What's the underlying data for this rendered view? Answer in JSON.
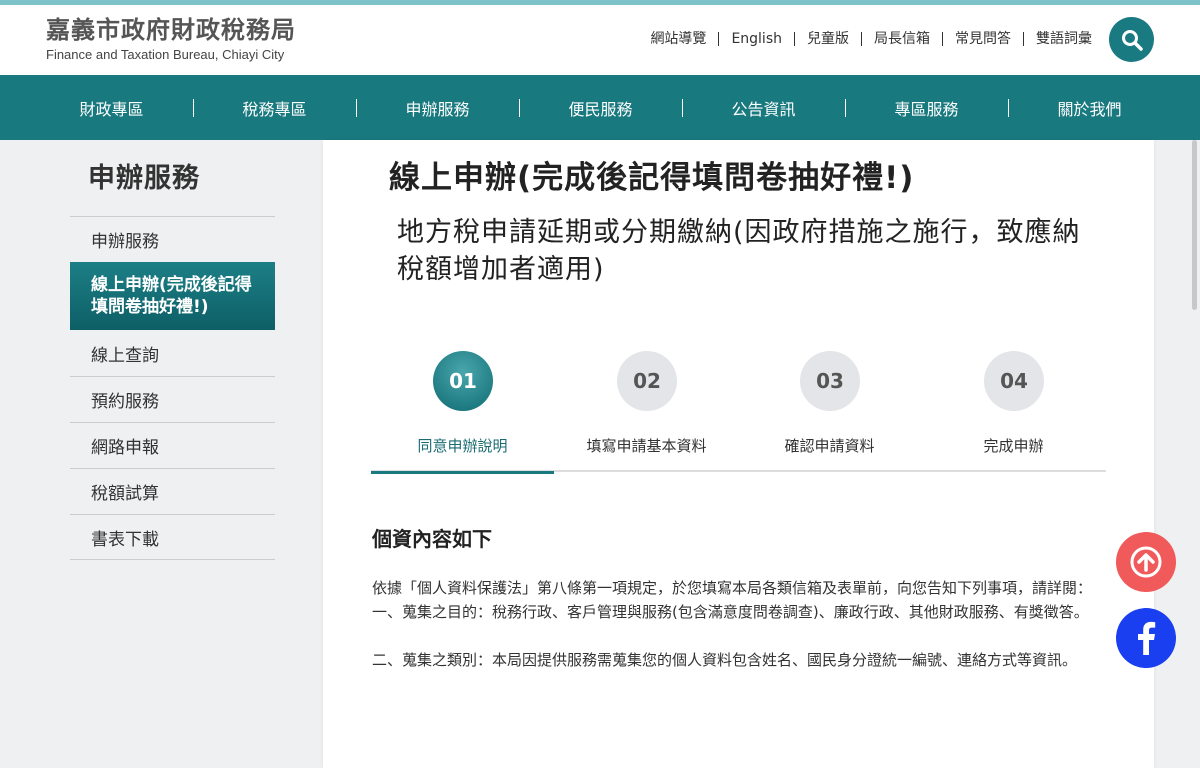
{
  "header": {
    "logo_cn": "嘉義市政府財政稅務局",
    "logo_en": "Finance and Taxation Bureau, Chiayi City",
    "links": [
      "網站導覽",
      "English",
      "兒童版",
      "局長信箱",
      "常見問答",
      "雙語詞彙"
    ],
    "search_icon": "search-icon"
  },
  "nav": {
    "items": [
      "財政專區",
      "稅務專區",
      "申辦服務",
      "便民服務",
      "公告資訊",
      "專區服務",
      "關於我們"
    ]
  },
  "sidebar": {
    "title": "申辦服務",
    "items": [
      "申辦服務",
      "線上申辦(完成後記得填問卷抽好禮!)",
      "線上查詢",
      "預約服務",
      "網路申報",
      "稅額試算",
      "書表下載"
    ],
    "active_index": 1
  },
  "main": {
    "title": "線上申辦(完成後記得填問卷抽好禮!)",
    "subtitle": "地方稅申請延期或分期繳納(因政府措施之施行，致應納稅額增加者適用)",
    "steps": [
      {
        "num": "01",
        "label": "同意申辦說明"
      },
      {
        "num": "02",
        "label": "填寫申請基本資料"
      },
      {
        "num": "03",
        "label": "確認申請資料"
      },
      {
        "num": "04",
        "label": "完成申辦"
      }
    ],
    "active_step": 0,
    "section_title": "個資內容如下",
    "paragraphs": [
      "依據「個人資料保護法」第八條第一項規定，於您填寫本局各類信箱及表單前，向您告知下列事項，請詳閱：",
      "一、蒐集之目的：稅務行政、客戶管理與服務(包含滿意度問卷調查)、廉政行政、其他財政服務、有獎徵答。",
      "二、蒐集之類別：本局因提供服務需蒐集您的個人資料包含姓名、國民身分證統一編號、連絡方式等資訊。"
    ]
  },
  "floating": {
    "top_icon": "arrow-up-icon",
    "fb_icon": "facebook-icon"
  },
  "colors": {
    "primary": "#18797f",
    "top_button": "#f15a5a",
    "facebook": "#1a3ff0"
  }
}
